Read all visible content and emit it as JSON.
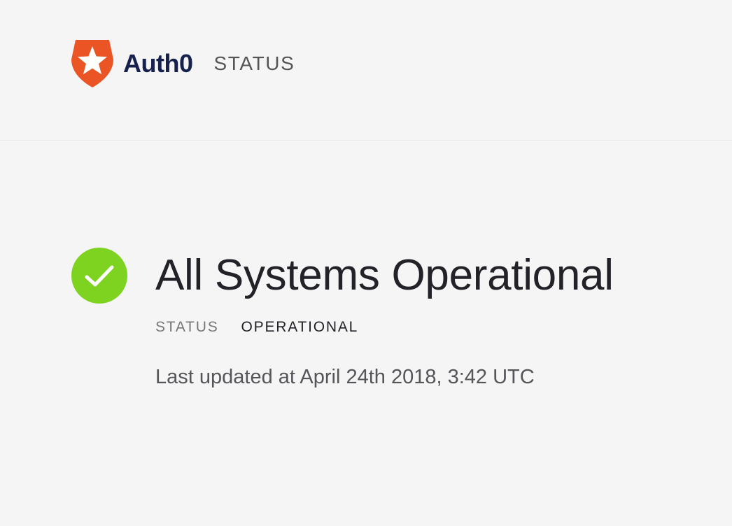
{
  "header": {
    "brand_name": "Auth0",
    "section_label": "STATUS",
    "brand_color": "#eb5424",
    "wordmark_color": "#16214d"
  },
  "status": {
    "headline": "All Systems Operational",
    "label": "STATUS",
    "value": "OPERATIONAL",
    "last_updated": "Last updated at April 24th 2018, 3:42 UTC",
    "indicator_color": "#7ed321",
    "indicator_icon": "checkmark-icon"
  }
}
